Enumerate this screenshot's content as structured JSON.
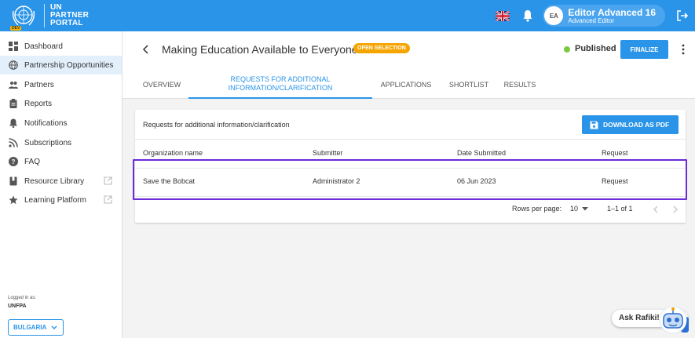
{
  "brand": {
    "line1": "UN",
    "line2": "PARTNER",
    "line3": "PORTAL",
    "badge": "DEV",
    "color": "#2a94e8"
  },
  "user": {
    "initials": "EA",
    "name": "Editor Advanced 16",
    "role": "Advanced Editor"
  },
  "sidebar": {
    "items": [
      {
        "label": "Dashboard",
        "icon": "dashboard-icon"
      },
      {
        "label": "Partnership Opportunities",
        "icon": "globe-icon"
      },
      {
        "label": "Partners",
        "icon": "people-icon"
      },
      {
        "label": "Reports",
        "icon": "clipboard-icon"
      },
      {
        "label": "Notifications",
        "icon": "bell-icon"
      },
      {
        "label": "Subscriptions",
        "icon": "rss-icon"
      },
      {
        "label": "FAQ",
        "icon": "help-icon"
      },
      {
        "label": "Resource Library",
        "icon": "book-icon"
      },
      {
        "label": "Learning Platform",
        "icon": "star-icon"
      }
    ],
    "logged_label": "Logged in as:",
    "logged_org": "UNFPA",
    "country": "BULGARIA"
  },
  "header": {
    "title": "Making Education Available to Everyone",
    "status": "OPEN SELECTION",
    "status_color": "#f5a400",
    "published": "Published",
    "finalize": "FINALIZE",
    "tabs": [
      {
        "label": "OVERVIEW"
      },
      {
        "label": "REQUESTS FOR ADDITIONAL INFORMATION/CLARIFICATION"
      },
      {
        "label": "APPLICATIONS"
      },
      {
        "label": "SHORTLIST"
      },
      {
        "label": "RESULTS"
      }
    ]
  },
  "card": {
    "title": "Requests for additional information/clarification",
    "download": "DOWNLOAD AS PDF",
    "columns": [
      "Organization name",
      "Submitter",
      "Date Submitted",
      "Request"
    ],
    "rows": [
      [
        "Save the Bobcat",
        "Administrator 2",
        "06 Jun 2023",
        "Request"
      ]
    ],
    "rows_per_page_label": "Rows per page:",
    "rows_per_page": "10",
    "range": "1–1 of 1"
  },
  "assistant": {
    "label": "Ask Rafiki!"
  }
}
